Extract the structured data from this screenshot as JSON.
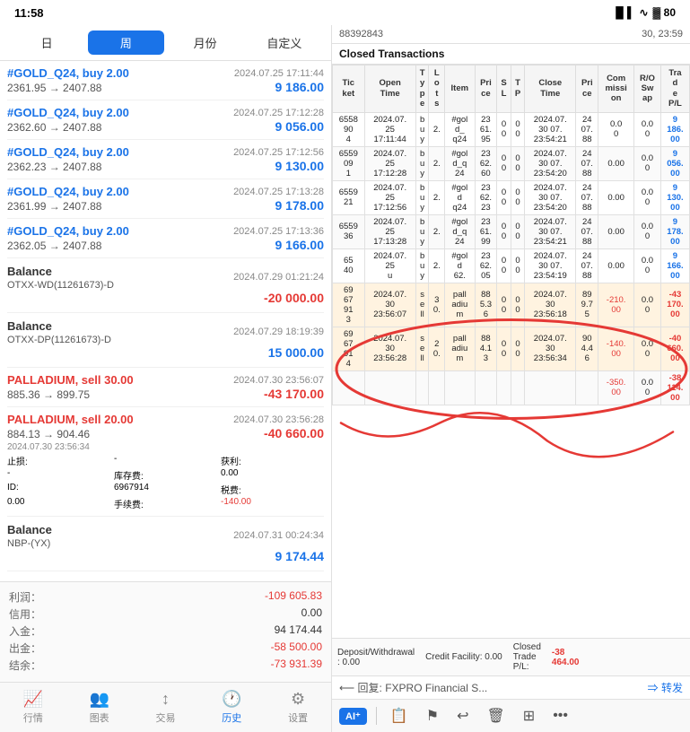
{
  "statusBar": {
    "time": "11:58",
    "battery": "80"
  },
  "tabs": [
    {
      "label": "日",
      "active": false
    },
    {
      "label": "周",
      "active": true
    },
    {
      "label": "月份",
      "active": false
    },
    {
      "label": "自定义",
      "active": false
    }
  ],
  "transactions": [
    {
      "id": "tx1",
      "title": "#GOLD_Q24, buy 2.00",
      "type": "buy",
      "date": "2024.07.25 17:11:44",
      "prices": "2361.95 → 2407.88",
      "amount": "9 186.00",
      "amountType": "positive"
    },
    {
      "id": "tx2",
      "title": "#GOLD_Q24, buy 2.00",
      "type": "buy",
      "date": "2024.07.25 17:12:28",
      "prices": "2362.60 → 2407.88",
      "amount": "9 056.00",
      "amountType": "positive"
    },
    {
      "id": "tx3",
      "title": "#GOLD_Q24, buy 2.00",
      "type": "buy",
      "date": "2024.07.25 17:12:56",
      "prices": "2362.23 → 2407.88",
      "amount": "9 130.00",
      "amountType": "positive"
    },
    {
      "id": "tx4",
      "title": "#GOLD_Q24, buy 2.00",
      "type": "buy",
      "date": "2024.07.25 17:13:28",
      "prices": "2361.99 → 2407.88",
      "amount": "9 178.00",
      "amountType": "positive"
    },
    {
      "id": "tx5",
      "title": "#GOLD_Q24, buy 2.00",
      "type": "buy",
      "date": "2024.07.25 17:13:36",
      "prices": "2362.05 → 2407.88",
      "amount": "9 166.00",
      "amountType": "positive"
    },
    {
      "id": "tx6",
      "title": "Balance",
      "subtitle": "OTXX-WD(11261673)-D",
      "type": "balance",
      "date": "2024.07.29 01:21:24",
      "prices": "",
      "amount": "-20 000.00",
      "amountType": "negative"
    },
    {
      "id": "tx7",
      "title": "Balance",
      "subtitle": "OTXX-DP(11261673)-D",
      "type": "balance",
      "date": "2024.07.29 18:19:39",
      "prices": "",
      "amount": "15 000.00",
      "amountType": "positive"
    },
    {
      "id": "tx8",
      "title": "PALLADIUM, sell 30.00",
      "type": "sell",
      "date": "2024.07.30 23:56:07",
      "prices": "885.36 → 899.75",
      "amount": "-43 170.00",
      "amountType": "negative"
    },
    {
      "id": "tx9",
      "title": "PALLADIUM, sell 20.00",
      "type": "sell",
      "date": "2024.07.30 23:56:28",
      "prices": "884.13 → 904.46",
      "amount": "-40 660.00",
      "amountType": "negative",
      "hasDetail": true,
      "detailDate": "2024.07.30 23:56:34",
      "detailItems": [
        {
          "label": "止损:",
          "value": "-"
        },
        {
          "label": "库存费:",
          "value": "0.00"
        },
        {
          "label": "获利:",
          "value": "-"
        },
        {
          "label": "税费:",
          "value": "0.00"
        },
        {
          "label": "ID:",
          "value": "6967914"
        },
        {
          "label": "手续费:",
          "value": "-140.00"
        }
      ]
    },
    {
      "id": "tx10",
      "title": "Balance",
      "subtitle": "NBP-(YX)",
      "type": "balance",
      "date": "2024.07.31 00:24:34",
      "prices": "",
      "amount": "9 174.44",
      "amountType": "positive"
    }
  ],
  "summary": {
    "profitLabel": "利润：",
    "profitValue": "-109 605.83",
    "creditLabel": "信用：",
    "creditValue": "0.00",
    "depositLabel": "入金：",
    "depositValue": "94 174.44",
    "withdrawLabel": "出金：",
    "withdrawValue": "-58 500.00",
    "balanceLabel": "结余：",
    "balanceValue": "-73 931.39"
  },
  "bottomNav": [
    {
      "label": "行情",
      "icon": "📈",
      "active": false
    },
    {
      "label": "图表",
      "icon": "👥",
      "active": false
    },
    {
      "label": "交易",
      "icon": "↕",
      "active": false
    },
    {
      "label": "历史",
      "icon": "🕐",
      "active": true
    },
    {
      "label": "设置",
      "icon": "⚙",
      "active": false
    }
  ],
  "rightPanel": {
    "headerLeft": "88392843",
    "headerRight": "30, 23:59",
    "sectionTitle": "Closed Transactions",
    "tableHeaders": [
      "Tic\nket",
      "Open\nTime",
      "T\ny\np\ne",
      "L\no\nt\ns",
      "Item",
      "Pri\nce",
      "S\nL",
      "T\nP",
      "Close\nTime",
      "Pri\nce",
      "Com\nmissi\non",
      "R/O\nSw\nap",
      "Tra\nd\ne\nP/L"
    ],
    "tableRows": [
      [
        "6558\n904",
        "2024.07.\n25\n17:11:44",
        "b\nu\ny",
        "2.",
        "#gol\nd_\nq\n24",
        "23\n61.\n95",
        "0\n0",
        "0\n0",
        "2024.07.\n30 07.\n23:54:21",
        "24\n07.\n88",
        "0.0\n0",
        "0.0\n0",
        "9\n186.\n00"
      ],
      [
        "6559\n09\n1",
        "2024.07.\n25\n17:12:28",
        "b\nu\ny",
        "2.",
        "#gol\nd_q\n24",
        "23\n62.\n60",
        "0\n0",
        "0\n0",
        "2024.07.\n30 07.\n23:54:20",
        "24\n07.\n88",
        "0.00",
        "0.0\n0",
        "9\n056.\n00"
      ],
      [
        "6559\n21",
        "2024.07.\n25\n17:12:56",
        "b\nu\ny",
        "2.",
        "#gol\nd\nq\n24",
        "23\n62.\n23",
        "0\n0",
        "0\n0",
        "2024.07.\n30 07.\n23:54:20",
        "24\n07.\n88",
        "0.00",
        "0.0\n0",
        "9\n130.\n00"
      ],
      [
        "6559\n36",
        "2024.07.\n25\n17:13:28",
        "b\nu\ny",
        "2.",
        "#gol\nd_q\n24",
        "23\n61.\n99",
        "0\n0",
        "0\n0",
        "2024.07.\n30 07.\n23:54:21",
        "24\n07.\n88",
        "0.00",
        "0.0\n0",
        "9\n178.\n00"
      ],
      [
        "65\n40",
        "2024.07.\n25\nu",
        "b\nu\ny",
        "2.",
        "#gol\nd\n62.",
        "23\n62.\n05",
        "0\n0",
        "0\n0",
        "2024.07.\n30 07.\n23:54:19",
        "24\n07.\n88",
        "0.00",
        "0.0\n0",
        "9\n166.\n00"
      ],
      [
        "69\n67\n91\n3",
        "2024.07.\n30\n23:56:07",
        "s\ne\nll",
        "3\n0.",
        "pall\nadiu\nm",
        "88\n5.3\n6",
        "0\n0",
        "0\n0",
        "2024.07.\n30\n23:56:18",
        "89\n9.7\n5",
        "-210.\n00",
        "0.0\n0",
        "-43\n170.\n00"
      ],
      [
        "69\n67\n91\n4",
        "2024.07.\n30\n23:56:28",
        "s\ne\nll",
        "2\n0.",
        "pall\nadiu\nm",
        "88\n4.1\n3",
        "0\n0",
        "0\n0",
        "2024.07.\n30\n23:56:34",
        "90\n4.4\n6",
        "-140.\n00",
        "0.0\n0",
        "-40\n660.\n00"
      ]
    ],
    "footer": {
      "depositLabel": "Deposit/Withdrawal\n: 0.00",
      "creditLabel": "Credit Facility: 0.00",
      "closedLabel": "Closed\nTrade\nP/L:",
      "closedValue": "-38\n464.00"
    },
    "replyText": "⟵ 回复: FXPRO Financial S...",
    "forwardText": "⇒ 转发",
    "toolbarItems": [
      "AI⁺",
      "📋",
      "⚑",
      "↺",
      "🗑",
      "⊞",
      "..."
    ]
  }
}
